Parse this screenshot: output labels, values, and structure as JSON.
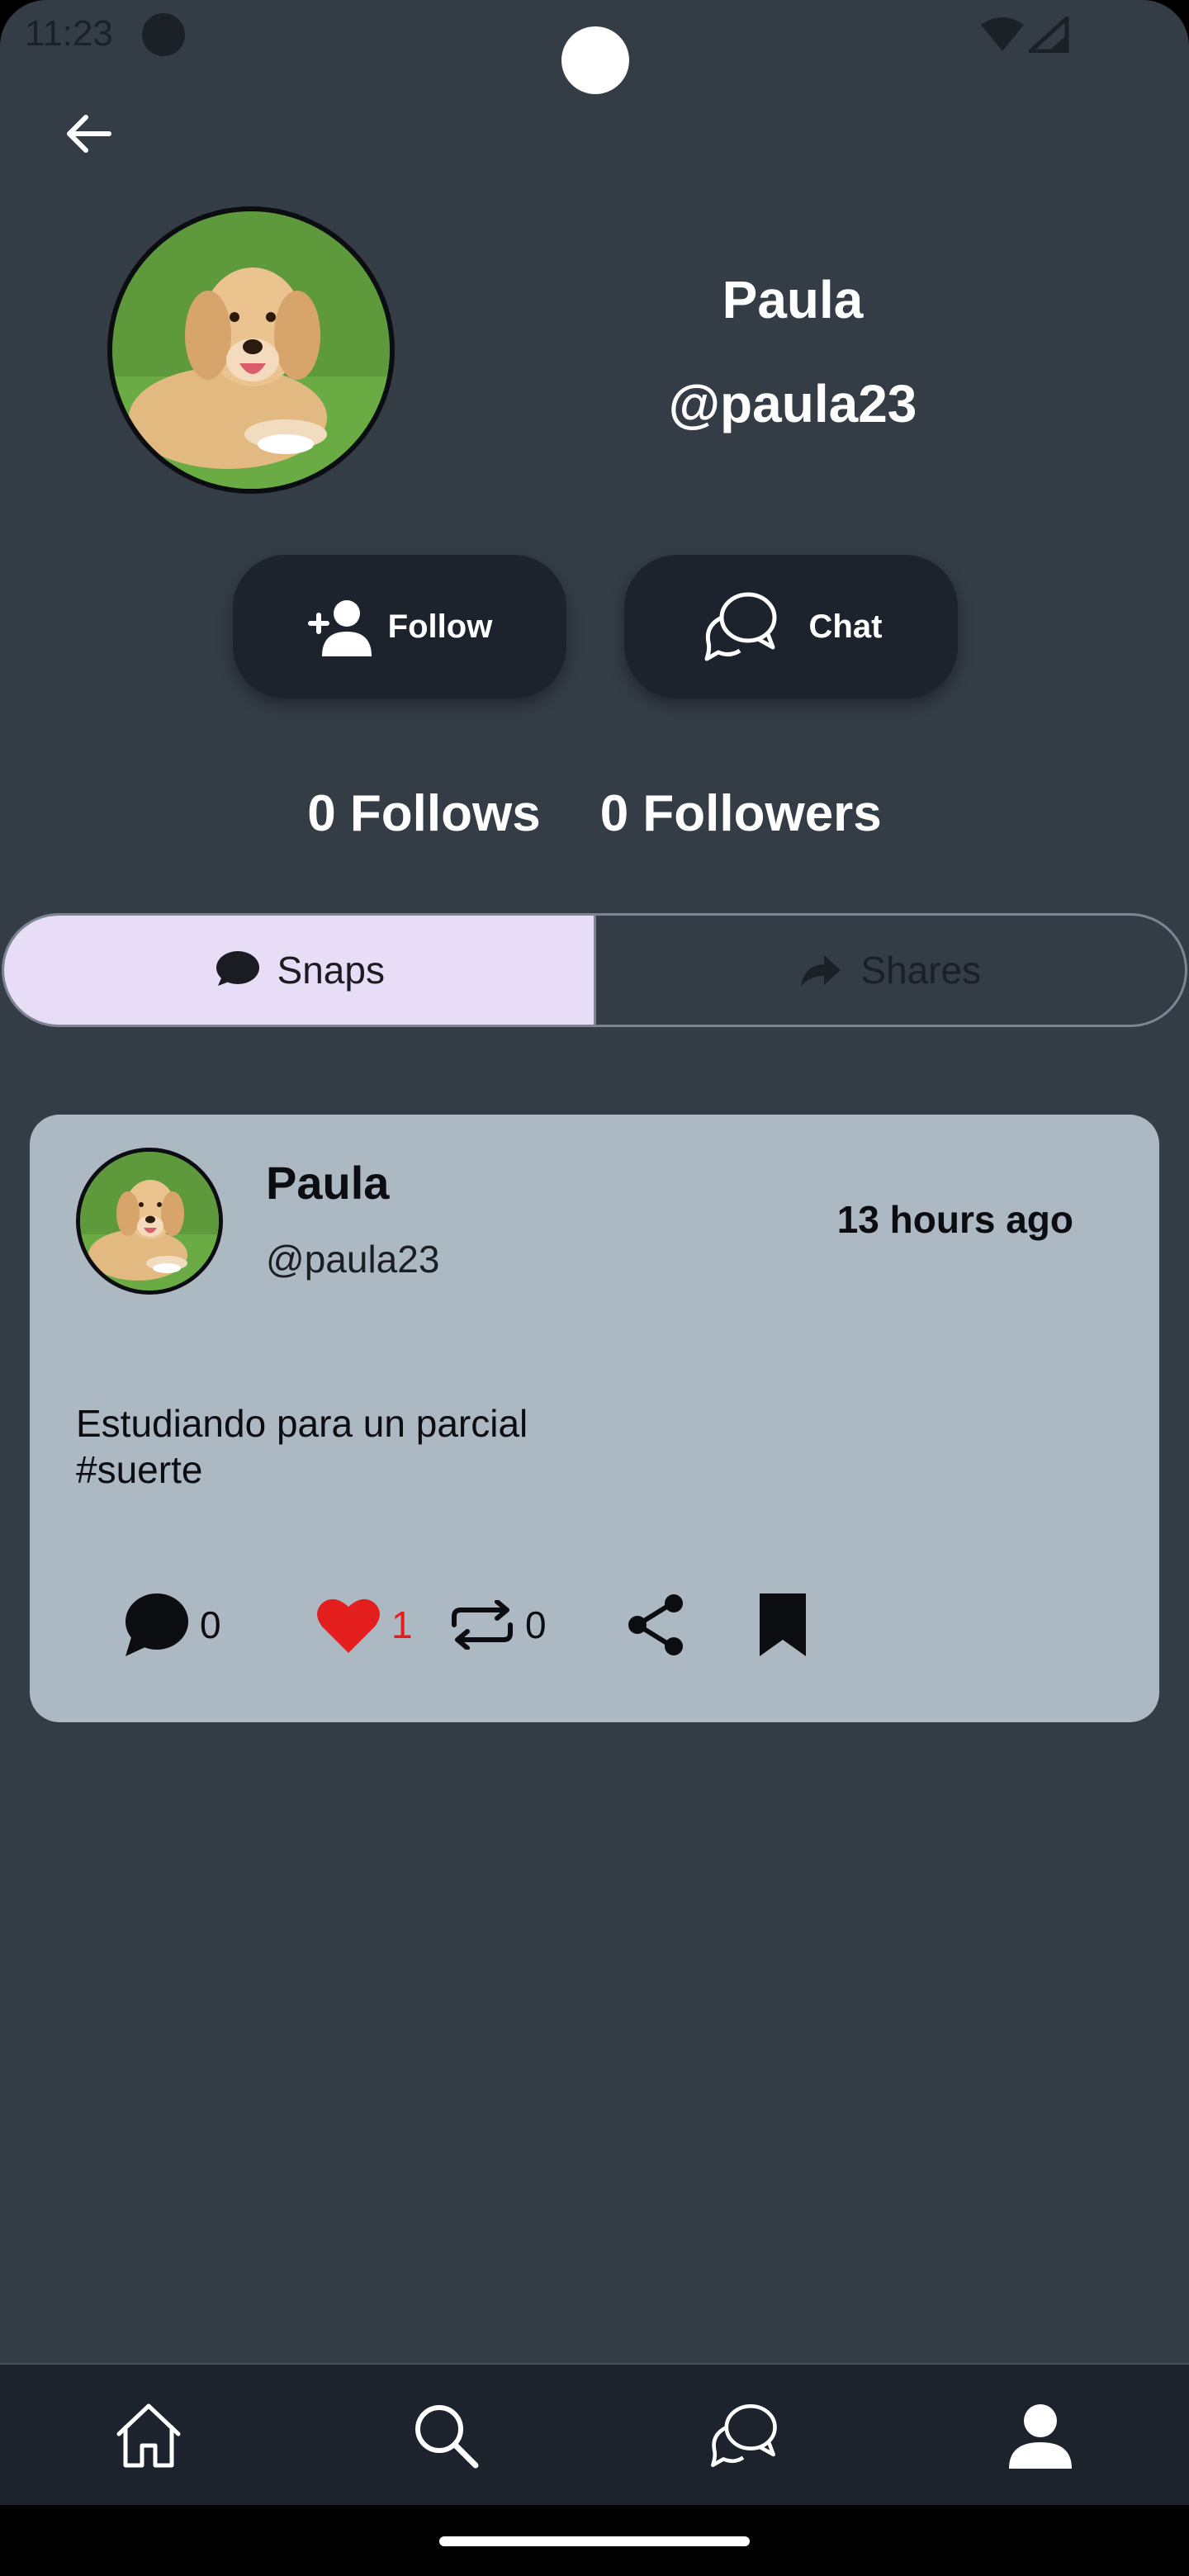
{
  "status_bar": {
    "time": "11:23",
    "icons": [
      "dot-icon",
      "wifi-icon",
      "signal-icon"
    ]
  },
  "header": {
    "back_icon": "arrow-back-icon"
  },
  "profile": {
    "name": "Paula",
    "handle": "@paula23",
    "avatar": "golden-retriever-photo"
  },
  "actions": {
    "follow_label": "Follow",
    "follow_icon": "person-add-icon",
    "chat_label": "Chat",
    "chat_icon": "chat-bubbles-icon"
  },
  "stats": {
    "follows": "0 Follows",
    "followers": "0 Followers"
  },
  "tabs": [
    {
      "label": "Snaps",
      "icon": "speech-bubble-icon",
      "selected": true
    },
    {
      "label": "Shares",
      "icon": "share-arrow-icon",
      "selected": false
    }
  ],
  "post": {
    "author_name": "Paula",
    "author_handle": "@paula23",
    "time_ago": "13 hours ago",
    "text_line1": "Estudiando para un parcial",
    "text_line2": "#suerte",
    "comments_count": "0",
    "likes_count": "1",
    "resnaps_count": "0",
    "liked": true,
    "saved": true
  },
  "bottom_nav": [
    {
      "name": "home",
      "icon": "home-icon"
    },
    {
      "name": "search",
      "icon": "search-icon"
    },
    {
      "name": "chats",
      "icon": "chat-bubbles-icon"
    },
    {
      "name": "profile",
      "icon": "person-icon",
      "selected": true
    }
  ],
  "colors": {
    "background": "#343c46",
    "button_bg": "#1c232c",
    "tab_selected_bg": "#e8ddf6",
    "card_bg": "#acb8c2",
    "like_red": "#e41d1d"
  }
}
